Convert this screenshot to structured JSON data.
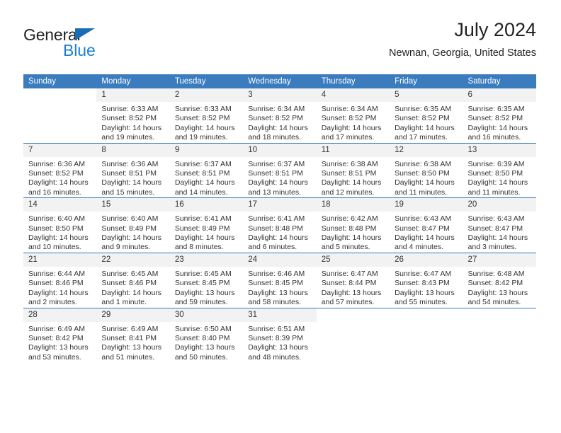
{
  "brand": {
    "name_primary": "General",
    "name_secondary": "Blue",
    "accent_color": "#1a7fd4",
    "triangle_color": "#1a6cb4"
  },
  "header": {
    "title": "July 2024",
    "subtitle": "Newnan, Georgia, United States"
  },
  "calendar": {
    "header_bg": "#3a7cbe",
    "daynum_bg": "#f2f2f2",
    "weekday_headers": [
      "Sunday",
      "Monday",
      "Tuesday",
      "Wednesday",
      "Thursday",
      "Friday",
      "Saturday"
    ],
    "weeks": [
      [
        {
          "day": "",
          "sunrise": "",
          "sunset": "",
          "daylight": ""
        },
        {
          "day": "1",
          "sunrise": "Sunrise: 6:33 AM",
          "sunset": "Sunset: 8:52 PM",
          "daylight": "Daylight: 14 hours and 19 minutes."
        },
        {
          "day": "2",
          "sunrise": "Sunrise: 6:33 AM",
          "sunset": "Sunset: 8:52 PM",
          "daylight": "Daylight: 14 hours and 19 minutes."
        },
        {
          "day": "3",
          "sunrise": "Sunrise: 6:34 AM",
          "sunset": "Sunset: 8:52 PM",
          "daylight": "Daylight: 14 hours and 18 minutes."
        },
        {
          "day": "4",
          "sunrise": "Sunrise: 6:34 AM",
          "sunset": "Sunset: 8:52 PM",
          "daylight": "Daylight: 14 hours and 17 minutes."
        },
        {
          "day": "5",
          "sunrise": "Sunrise: 6:35 AM",
          "sunset": "Sunset: 8:52 PM",
          "daylight": "Daylight: 14 hours and 17 minutes."
        },
        {
          "day": "6",
          "sunrise": "Sunrise: 6:35 AM",
          "sunset": "Sunset: 8:52 PM",
          "daylight": "Daylight: 14 hours and 16 minutes."
        }
      ],
      [
        {
          "day": "7",
          "sunrise": "Sunrise: 6:36 AM",
          "sunset": "Sunset: 8:52 PM",
          "daylight": "Daylight: 14 hours and 16 minutes."
        },
        {
          "day": "8",
          "sunrise": "Sunrise: 6:36 AM",
          "sunset": "Sunset: 8:51 PM",
          "daylight": "Daylight: 14 hours and 15 minutes."
        },
        {
          "day": "9",
          "sunrise": "Sunrise: 6:37 AM",
          "sunset": "Sunset: 8:51 PM",
          "daylight": "Daylight: 14 hours and 14 minutes."
        },
        {
          "day": "10",
          "sunrise": "Sunrise: 6:37 AM",
          "sunset": "Sunset: 8:51 PM",
          "daylight": "Daylight: 14 hours and 13 minutes."
        },
        {
          "day": "11",
          "sunrise": "Sunrise: 6:38 AM",
          "sunset": "Sunset: 8:51 PM",
          "daylight": "Daylight: 14 hours and 12 minutes."
        },
        {
          "day": "12",
          "sunrise": "Sunrise: 6:38 AM",
          "sunset": "Sunset: 8:50 PM",
          "daylight": "Daylight: 14 hours and 11 minutes."
        },
        {
          "day": "13",
          "sunrise": "Sunrise: 6:39 AM",
          "sunset": "Sunset: 8:50 PM",
          "daylight": "Daylight: 14 hours and 11 minutes."
        }
      ],
      [
        {
          "day": "14",
          "sunrise": "Sunrise: 6:40 AM",
          "sunset": "Sunset: 8:50 PM",
          "daylight": "Daylight: 14 hours and 10 minutes."
        },
        {
          "day": "15",
          "sunrise": "Sunrise: 6:40 AM",
          "sunset": "Sunset: 8:49 PM",
          "daylight": "Daylight: 14 hours and 9 minutes."
        },
        {
          "day": "16",
          "sunrise": "Sunrise: 6:41 AM",
          "sunset": "Sunset: 8:49 PM",
          "daylight": "Daylight: 14 hours and 8 minutes."
        },
        {
          "day": "17",
          "sunrise": "Sunrise: 6:41 AM",
          "sunset": "Sunset: 8:48 PM",
          "daylight": "Daylight: 14 hours and 6 minutes."
        },
        {
          "day": "18",
          "sunrise": "Sunrise: 6:42 AM",
          "sunset": "Sunset: 8:48 PM",
          "daylight": "Daylight: 14 hours and 5 minutes."
        },
        {
          "day": "19",
          "sunrise": "Sunrise: 6:43 AM",
          "sunset": "Sunset: 8:47 PM",
          "daylight": "Daylight: 14 hours and 4 minutes."
        },
        {
          "day": "20",
          "sunrise": "Sunrise: 6:43 AM",
          "sunset": "Sunset: 8:47 PM",
          "daylight": "Daylight: 14 hours and 3 minutes."
        }
      ],
      [
        {
          "day": "21",
          "sunrise": "Sunrise: 6:44 AM",
          "sunset": "Sunset: 8:46 PM",
          "daylight": "Daylight: 14 hours and 2 minutes."
        },
        {
          "day": "22",
          "sunrise": "Sunrise: 6:45 AM",
          "sunset": "Sunset: 8:46 PM",
          "daylight": "Daylight: 14 hours and 1 minute."
        },
        {
          "day": "23",
          "sunrise": "Sunrise: 6:45 AM",
          "sunset": "Sunset: 8:45 PM",
          "daylight": "Daylight: 13 hours and 59 minutes."
        },
        {
          "day": "24",
          "sunrise": "Sunrise: 6:46 AM",
          "sunset": "Sunset: 8:45 PM",
          "daylight": "Daylight: 13 hours and 58 minutes."
        },
        {
          "day": "25",
          "sunrise": "Sunrise: 6:47 AM",
          "sunset": "Sunset: 8:44 PM",
          "daylight": "Daylight: 13 hours and 57 minutes."
        },
        {
          "day": "26",
          "sunrise": "Sunrise: 6:47 AM",
          "sunset": "Sunset: 8:43 PM",
          "daylight": "Daylight: 13 hours and 55 minutes."
        },
        {
          "day": "27",
          "sunrise": "Sunrise: 6:48 AM",
          "sunset": "Sunset: 8:42 PM",
          "daylight": "Daylight: 13 hours and 54 minutes."
        }
      ],
      [
        {
          "day": "28",
          "sunrise": "Sunrise: 6:49 AM",
          "sunset": "Sunset: 8:42 PM",
          "daylight": "Daylight: 13 hours and 53 minutes."
        },
        {
          "day": "29",
          "sunrise": "Sunrise: 6:49 AM",
          "sunset": "Sunset: 8:41 PM",
          "daylight": "Daylight: 13 hours and 51 minutes."
        },
        {
          "day": "30",
          "sunrise": "Sunrise: 6:50 AM",
          "sunset": "Sunset: 8:40 PM",
          "daylight": "Daylight: 13 hours and 50 minutes."
        },
        {
          "day": "31",
          "sunrise": "Sunrise: 6:51 AM",
          "sunset": "Sunset: 8:39 PM",
          "daylight": "Daylight: 13 hours and 48 minutes."
        },
        {
          "day": "",
          "sunrise": "",
          "sunset": "",
          "daylight": ""
        },
        {
          "day": "",
          "sunrise": "",
          "sunset": "",
          "daylight": ""
        },
        {
          "day": "",
          "sunrise": "",
          "sunset": "",
          "daylight": ""
        }
      ]
    ]
  }
}
